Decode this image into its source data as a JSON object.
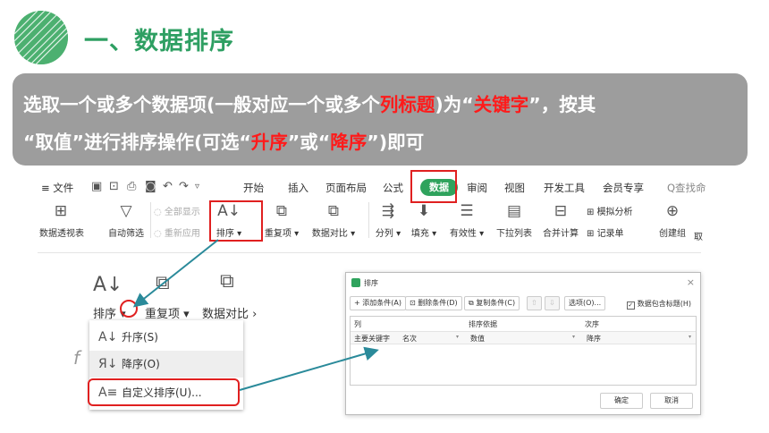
{
  "title": "一、数据排序",
  "banner": {
    "line1_a": "选取一个或多个数据项(一般对应一个或多个",
    "line1_red1": "列标题",
    "line1_b": ")为“",
    "line1_red2": "关键字",
    "line1_c": "”，按其",
    "line2_a": "“取值”进行排序操作(可选“",
    "line2_red1": "升序",
    "line2_b": "”或“",
    "line2_red2": "降序",
    "line2_c": "”)即可"
  },
  "menu": {
    "file": "≡ 文件",
    "tabs": [
      "开始",
      "插入",
      "页面布局",
      "公式",
      "数据",
      "审阅",
      "视图",
      "开发工具",
      "会员专享"
    ],
    "search": "Q查找命"
  },
  "tools": {
    "pivot": "数据透视表",
    "autofilter": "自动筛选",
    "show_all": "全部显示",
    "reapply": "重新应用",
    "sort": "排序",
    "duplicates": "重复项",
    "compare": "数据对比",
    "split": "分列",
    "fill": "填充",
    "validity": "有效性",
    "dropdown_list": "下拉列表",
    "consolidate": "合并计算",
    "simulate": "模拟分析",
    "record": "记录单",
    "group": "创建组",
    "cut": "取"
  },
  "zoom": {
    "sort": "排序",
    "duplicates": "重复项",
    "compare": "数据对比",
    "menu": [
      "升序(S)",
      "降序(O)",
      "自定义排序(U)..."
    ]
  },
  "dialog": {
    "title": "排序",
    "add": "+ 添加条件(A)",
    "delete": "删除条件(D)",
    "copy": "复制条件(C)",
    "options": "选项(O)...",
    "has_header": "数据包含标题(H)",
    "col_header": "列",
    "basis_header": "排序依据",
    "order_header": "次序",
    "row_key_label": "主要关键字",
    "row_key_value": "名次",
    "row_basis": "数值",
    "row_order": "降序",
    "ok": "确定",
    "cancel": "取消"
  },
  "colors": {
    "accent_green": "#2fa35d",
    "highlight_red": "#e02020",
    "arrow_teal": "#2a8a9a"
  }
}
